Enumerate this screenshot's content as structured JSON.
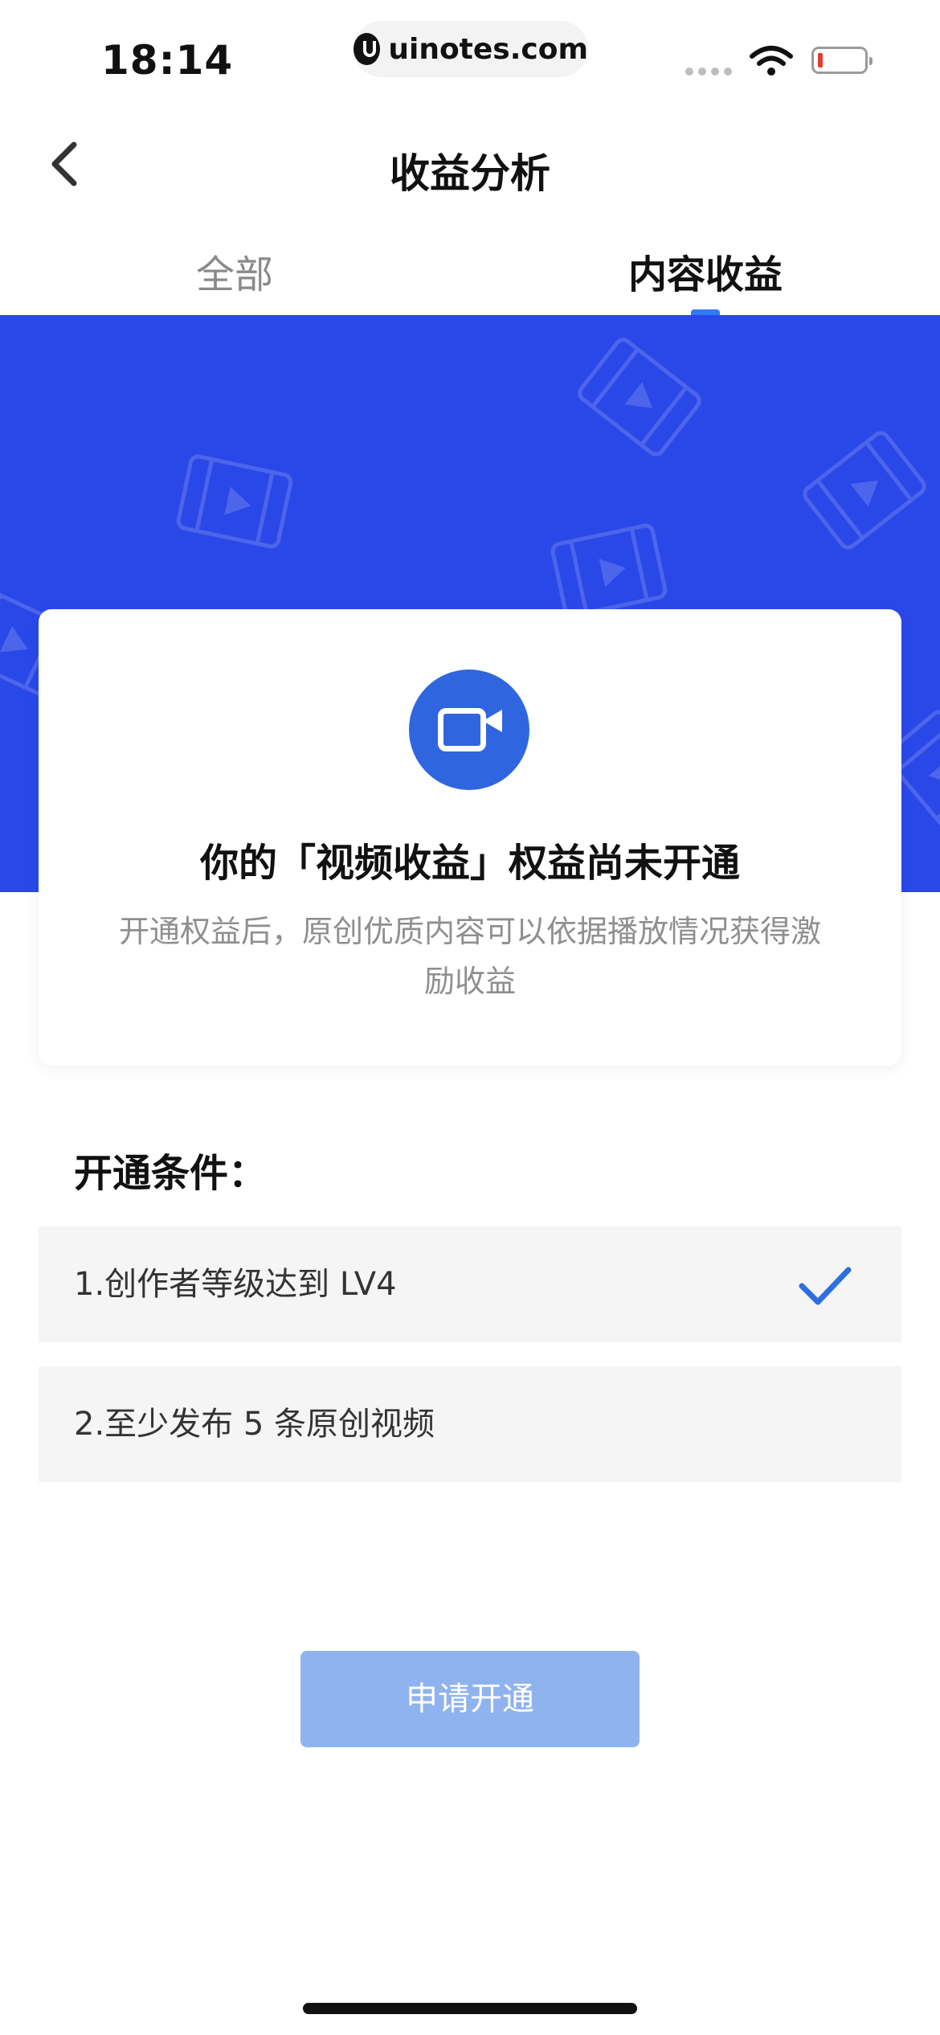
{
  "status_bar": {
    "time": "18:14",
    "url": "uinotes.com"
  },
  "nav": {
    "title": "收益分析"
  },
  "tabs": [
    {
      "label": "全部",
      "active": false
    },
    {
      "label": "内容收益",
      "active": true
    }
  ],
  "card": {
    "icon": "video-camera-icon",
    "title": "你的「视频收益」权益尚未开通",
    "description": "开通权益后，原创优质内容可以依据播放情况获得激励收益"
  },
  "conditions": {
    "title": "开通条件：",
    "items": [
      {
        "label": "1.创作者等级达到 LV4",
        "met": true
      },
      {
        "label": "2.至少发布 5 条原创视频",
        "met": false
      }
    ]
  },
  "apply_button": {
    "label": "申请开通",
    "enabled": false
  },
  "colors": {
    "banner": "#2a48e8",
    "accent": "#2e7cf6",
    "button_disabled": "#8fb3ef"
  }
}
